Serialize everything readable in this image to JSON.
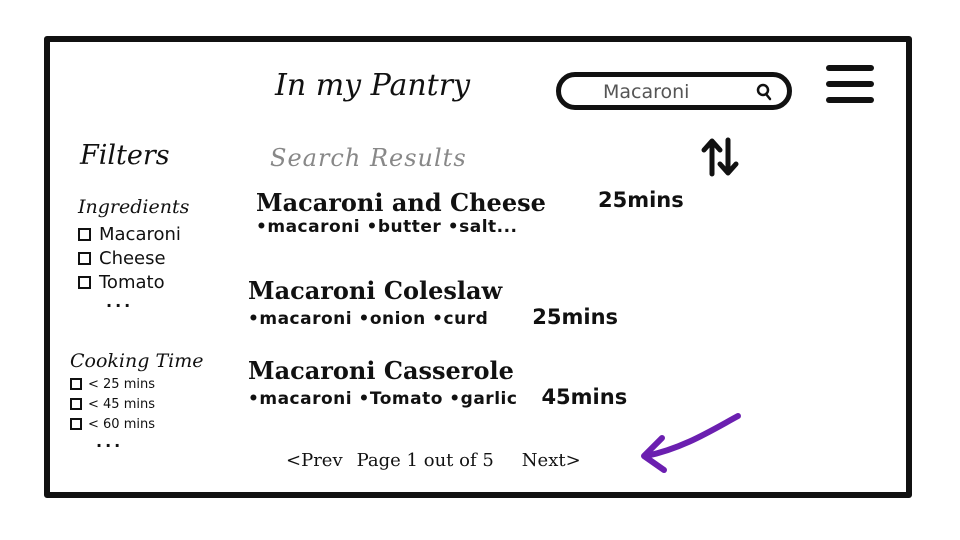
{
  "header": {
    "title": "In my Pantry",
    "search": {
      "value": "Macaroni"
    }
  },
  "filters": {
    "title": "Filters",
    "ingredients": {
      "title": "Ingredients",
      "options": [
        "Macaroni",
        "Cheese",
        "Tomato"
      ],
      "more": "..."
    },
    "cooking_time": {
      "title": "Cooking Time",
      "options": [
        "< 25 mins",
        "< 45 mins",
        "< 60 mins"
      ],
      "more": "..."
    }
  },
  "results": {
    "title": "Search Results",
    "items": [
      {
        "name": "Macaroni and Cheese",
        "time": "25mins",
        "ingredients": "•macaroni •butter •salt..."
      },
      {
        "name": "Macaroni Coleslaw",
        "time": "25mins",
        "ingredients": "•macaroni •onion •curd"
      },
      {
        "name": "Macaroni Casserole",
        "time": "45mins",
        "ingredients": "•macaroni •Tomato •garlic"
      }
    ]
  },
  "pagination": {
    "prev_label": "<Prev",
    "page_label": "Page 1 out of 5",
    "next_label": "Next>",
    "current_page": 1,
    "total_pages": 5
  },
  "colors": {
    "ink": "#111111",
    "muted": "#888888",
    "annotation_arrow": "#6b1fb0"
  },
  "icons": [
    "search-icon",
    "menu-icon",
    "sort-icon",
    "arrow-icon"
  ]
}
